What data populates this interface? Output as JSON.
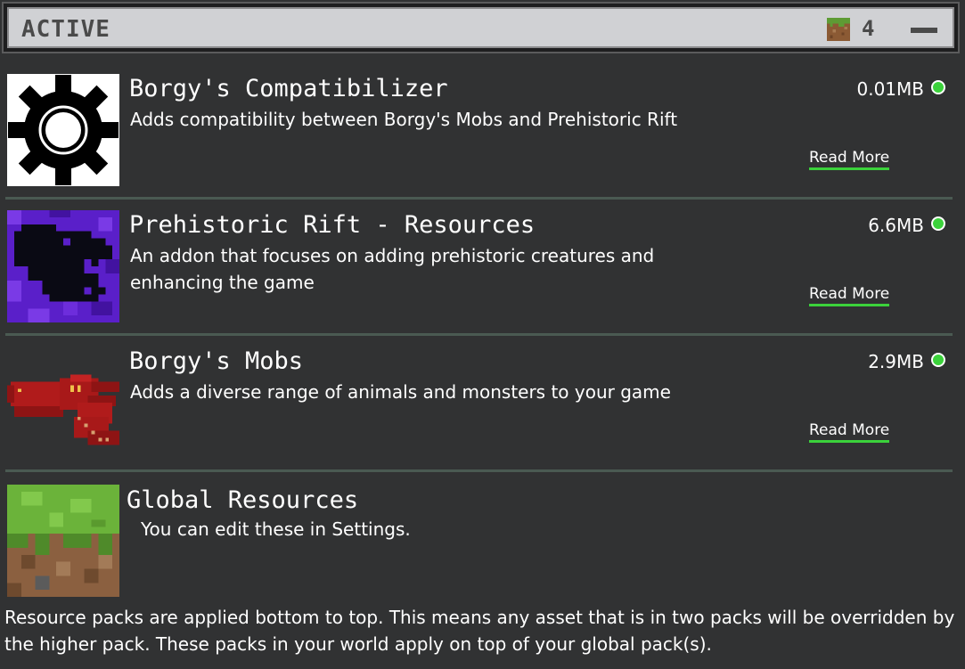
{
  "header": {
    "title": "ACTIVE",
    "pack_count": "4",
    "grass_icon": "grass-block-icon",
    "collapse_icon": "minus-icon"
  },
  "packs": [
    {
      "name": "Borgy's Compatibilizer",
      "description": "Adds compatibility between Borgy's Mobs and Prehistoric Rift",
      "size": "0.01MB",
      "read_more": "Read More",
      "icon": "gear-icon"
    },
    {
      "name": "Prehistoric Rift - Resources",
      "description": "An addon that focuses on adding prehistoric creatures and enhancing the game",
      "size": "6.6MB",
      "read_more": "Read More",
      "icon": "dinosaur-skull-icon"
    },
    {
      "name": "Borgy's Mobs",
      "description": "Adds a diverse range of animals and monsters to your game",
      "size": "2.9MB",
      "read_more": "Read More",
      "icon": "red-dragon-head-icon"
    }
  ],
  "global": {
    "name": "Global Resources",
    "description": "You can edit these in Settings.",
    "icon": "grass-block-icon"
  },
  "footer_note": "Resource packs are applied bottom to top. This means any asset that is in two packs will be overridden by the higher pack. These packs in your world apply on top of your global pack(s).",
  "colors": {
    "background": "#313233",
    "status_active": "#3bd23b",
    "header_bg": "#d0d1d4"
  }
}
